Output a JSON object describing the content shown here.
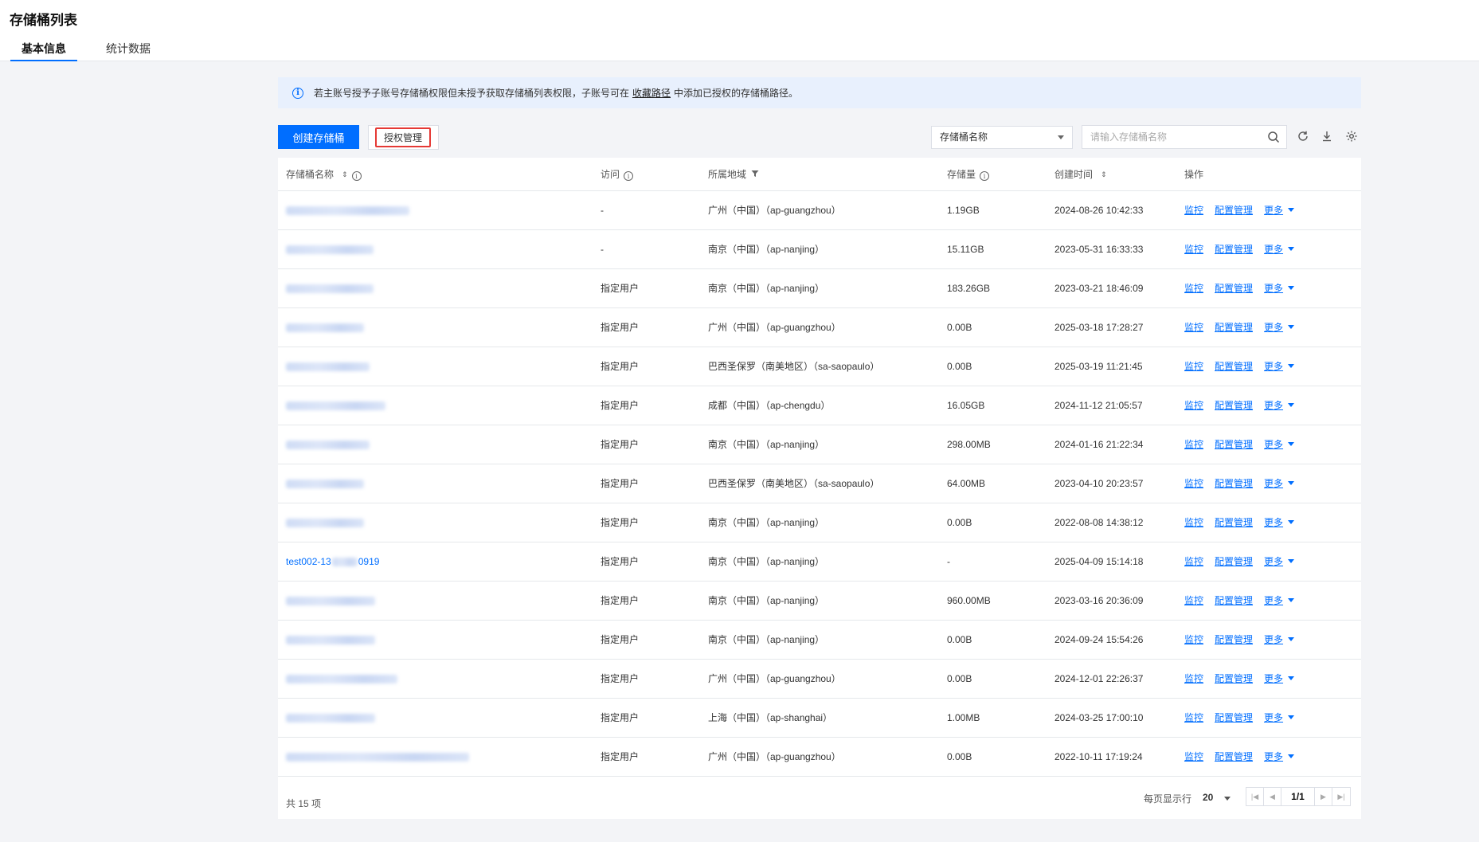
{
  "header": {
    "title": "存储桶列表",
    "tabs": [
      {
        "label": "基本信息",
        "active": true
      },
      {
        "label": "统计数据",
        "active": false
      }
    ]
  },
  "notice": {
    "text_before": "若主账号授予子账号存储桶权限但未授予获取存储桶列表权限，子账号可在",
    "link": "收藏路径",
    "text_after": "中添加已授权的存储桶路径。"
  },
  "toolbar": {
    "create_label": "创建存储桶",
    "auth_label": "授权管理",
    "select_value": "存储桶名称",
    "search_placeholder": "请输入存储桶名称",
    "icons": [
      "refresh-icon",
      "download-icon",
      "settings-icon"
    ]
  },
  "table": {
    "columns": [
      "存储桶名称",
      "访问",
      "所属地域",
      "存储量",
      "创建时间",
      "操作"
    ],
    "ops": {
      "monitor": "监控",
      "config": "配置管理",
      "more": "更多"
    },
    "rows": [
      {
        "name": "",
        "access": "-",
        "region": "广州（中国）（ap-guangzhou）",
        "size": "1.19GB",
        "created": "2024-08-26 10:42:33"
      },
      {
        "name": "",
        "access": "-",
        "region": "南京（中国）（ap-nanjing）",
        "size": "15.11GB",
        "created": "2023-05-31 16:33:33"
      },
      {
        "name": "",
        "access": "指定用户",
        "region": "南京（中国）（ap-nanjing）",
        "size": "183.26GB",
        "created": "2023-03-21 18:46:09"
      },
      {
        "name": "",
        "access": "指定用户",
        "region": "广州（中国）（ap-guangzhou）",
        "size": "0.00B",
        "created": "2025-03-18 17:28:27"
      },
      {
        "name": "",
        "access": "指定用户",
        "region": "巴西圣保罗（南美地区）（sa-saopaulo）",
        "size": "0.00B",
        "created": "2025-03-19 11:21:45"
      },
      {
        "name": "",
        "access": "指定用户",
        "region": "成都（中国）（ap-chengdu）",
        "size": "16.05GB",
        "created": "2024-11-12 21:05:57"
      },
      {
        "name": "",
        "access": "指定用户",
        "region": "南京（中国）（ap-nanjing）",
        "size": "298.00MB",
        "created": "2024-01-16 21:22:34"
      },
      {
        "name": "",
        "access": "指定用户",
        "region": "巴西圣保罗（南美地区）（sa-saopaulo）",
        "size": "64.00MB",
        "created": "2023-04-10 20:23:57"
      },
      {
        "name": "",
        "access": "指定用户",
        "region": "南京（中国）（ap-nanjing）",
        "size": "0.00B",
        "created": "2022-08-08 14:38:12"
      },
      {
        "name": "test002-13",
        "name_suffix": "0919",
        "access": "指定用户",
        "region": "南京（中国）（ap-nanjing）",
        "size": "-",
        "created": "2025-04-09 15:14:18"
      },
      {
        "name": "",
        "access": "指定用户",
        "region": "南京（中国）（ap-nanjing）",
        "size": "960.00MB",
        "created": "2023-03-16 20:36:09"
      },
      {
        "name": "",
        "access": "指定用户",
        "region": "南京（中国）（ap-nanjing）",
        "size": "0.00B",
        "created": "2024-09-24 15:54:26"
      },
      {
        "name": "",
        "access": "指定用户",
        "region": "广州（中国）（ap-guangzhou）",
        "size": "0.00B",
        "created": "2024-12-01 22:26:37"
      },
      {
        "name": "",
        "access": "指定用户",
        "region": "上海（中国）（ap-shanghai）",
        "size": "1.00MB",
        "created": "2024-03-25 17:00:10"
      },
      {
        "name": "",
        "access": "指定用户",
        "region": "广州（中国）（ap-guangzhou）",
        "size": "0.00B",
        "created": "2022-10-11 17:19:24"
      }
    ]
  },
  "footer": {
    "total": "共 15 项",
    "per_page_label": "每页显示行",
    "per_page_value": "20",
    "page": "1/1"
  }
}
